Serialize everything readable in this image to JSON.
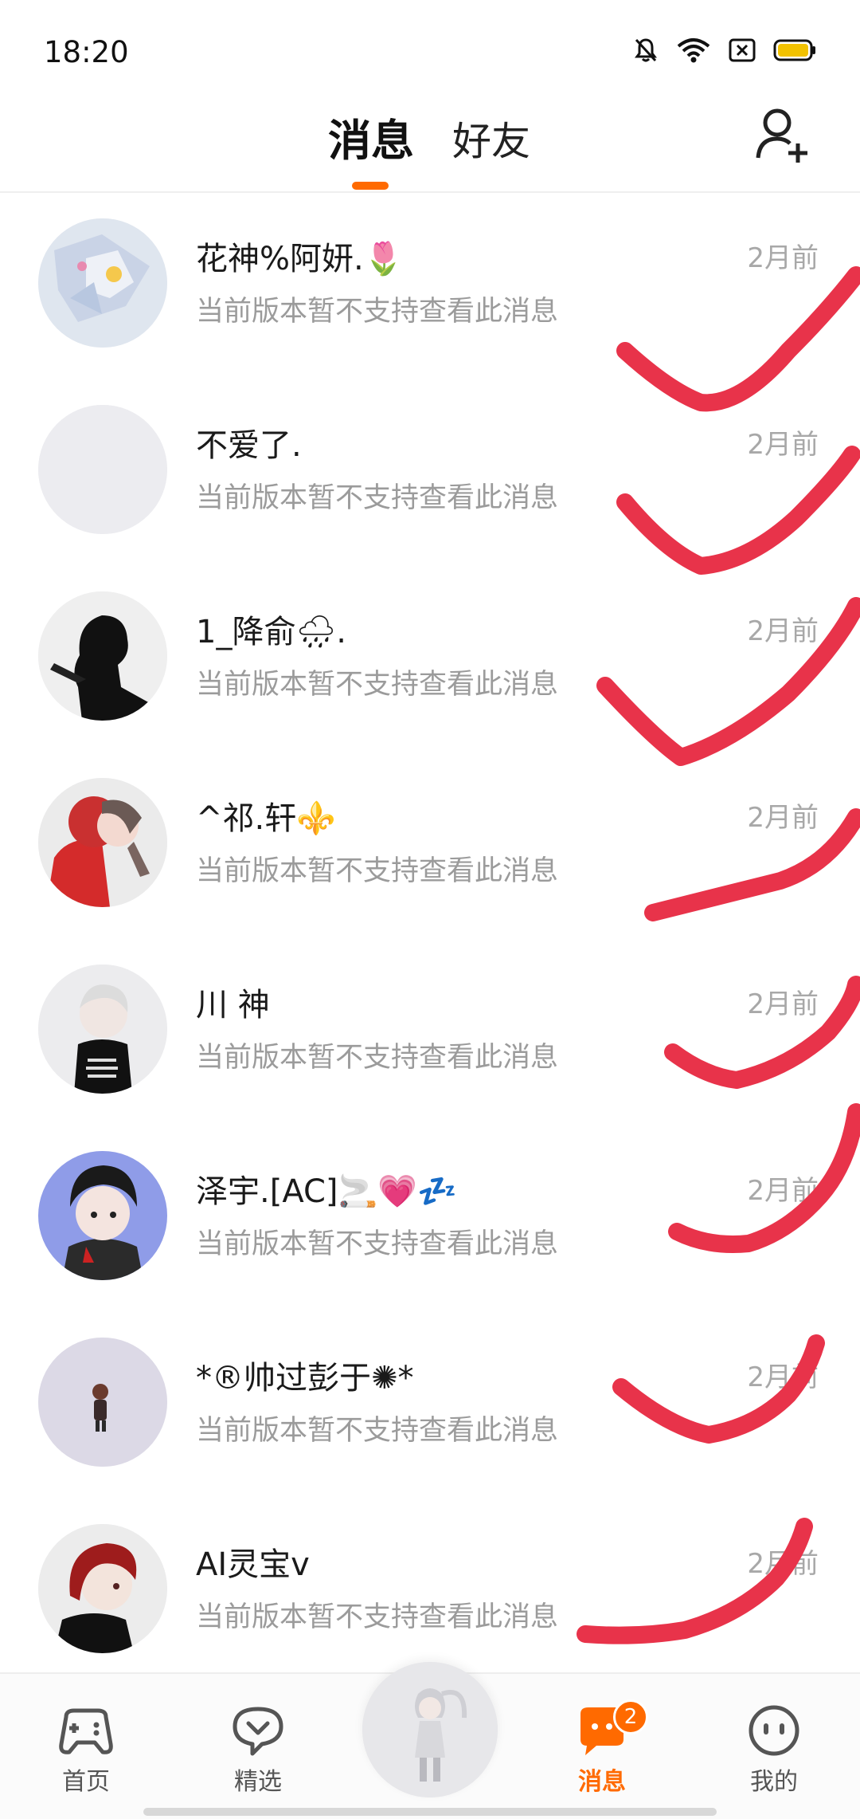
{
  "status": {
    "time": "18:20"
  },
  "header": {
    "tabs": [
      {
        "label": "消息",
        "active": true
      },
      {
        "label": "好友",
        "active": false
      }
    ]
  },
  "messages": [
    {
      "name": "花神%阿妍.🌷",
      "preview": "当前版本暂不支持查看此消息",
      "time": "2月前"
    },
    {
      "name": "不爱了.",
      "preview": "当前版本暂不支持查看此消息",
      "time": "2月前"
    },
    {
      "name": "1_降俞🌧.",
      "preview": "当前版本暂不支持查看此消息",
      "time": "2月前"
    },
    {
      "name": "^祁.轩⚜️",
      "preview": "当前版本暂不支持查看此消息",
      "time": "2月前"
    },
    {
      "name": "川  神",
      "preview": "当前版本暂不支持查看此消息",
      "time": "2月前"
    },
    {
      "name": "泽宇.[AC]🚬💗💤",
      "preview": "当前版本暂不支持查看此消息",
      "time": "2月前"
    },
    {
      "name": "*®帅过彭于✺*",
      "preview": "当前版本暂不支持查看此消息",
      "time": "2月前"
    },
    {
      "name": "AI灵宝v",
      "preview": "当前版本暂不支持查看此消息",
      "time": "2月前"
    }
  ],
  "bottom_nav": {
    "items": [
      {
        "label": "首页",
        "icon": "gamepad-icon"
      },
      {
        "label": "精选",
        "icon": "heart-chat-icon"
      },
      {
        "label": "消息",
        "icon": "message-icon",
        "active": true,
        "badge": "2"
      },
      {
        "label": "我的",
        "icon": "face-icon"
      }
    ]
  },
  "colors": {
    "accent": "#ff6a00",
    "annotation": "#e8334a"
  }
}
